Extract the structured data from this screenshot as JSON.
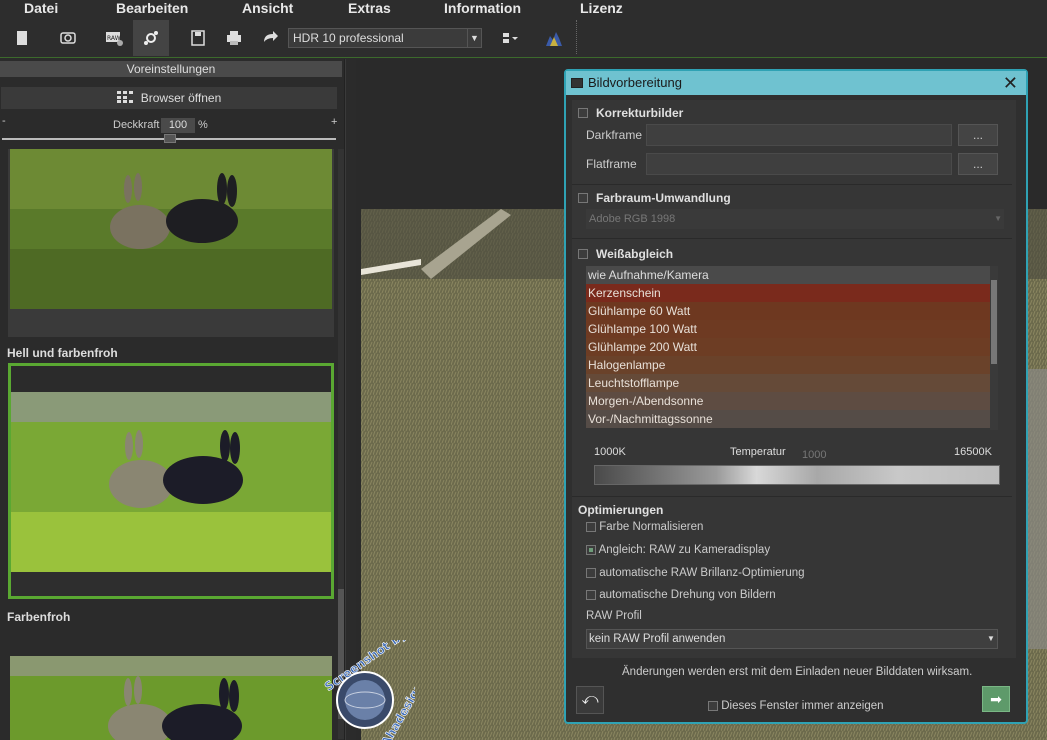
{
  "menu": [
    "Datei",
    "Bearbeiten",
    "Ansicht",
    "Extras",
    "Information",
    "Lizenz"
  ],
  "toolbar": {
    "preset_value": "HDR 10 professional",
    "icons": [
      "new-file-icon",
      "camera-icon",
      "raw-icon",
      "bracket-icon",
      "save-icon",
      "print-icon",
      "share-icon",
      "layout-icon",
      "histogram-icon"
    ]
  },
  "left_panel": {
    "header": "Voreinstellungen",
    "browser_button": "Browser öffnen",
    "opacity_label": "Deckkraft",
    "opacity_value": "100",
    "opacity_unit": "%",
    "slider_min": "-",
    "slider_max": "+",
    "presets": [
      {
        "title": ""
      },
      {
        "title": "Hell und farbenfroh"
      },
      {
        "title": "Farbenfroh"
      }
    ]
  },
  "dialog": {
    "title": "Bildvorbereitung",
    "korrektur": {
      "title": "Korrekturbilder",
      "darkframe_label": "Darkframe",
      "flatframe_label": "Flatframe",
      "browse_label": "..."
    },
    "farbraum": {
      "title": "Farbraum-Umwandlung",
      "value": "Adobe RGB 1998"
    },
    "weissabgleich": {
      "title": "Weißabgleich",
      "items": [
        {
          "label": "wie Aufnahme/Kamera",
          "color": "#4a4a4a"
        },
        {
          "label": "Kerzenschein",
          "color": "#7a2a1c"
        },
        {
          "label": "Glühlampe 60 Watt",
          "color": "#6e3820"
        },
        {
          "label": "Glühlampe 100 Watt",
          "color": "#6e3a22"
        },
        {
          "label": "Glühlampe 200 Watt",
          "color": "#6d3d24"
        },
        {
          "label": "Halogenlampe",
          "color": "#6a422a"
        },
        {
          "label": "Leuchtstofflampe",
          "color": "#654a38"
        },
        {
          "label": "Morgen-/Abendsonne",
          "color": "#5e4c42"
        },
        {
          "label": "Vor-/Nachmittagssonne",
          "color": "#554c47"
        }
      ],
      "temp_min": "1000K",
      "temp_label": "Temperatur",
      "temp_value": "1000",
      "temp_max": "16500K"
    },
    "optimierungen": {
      "title": "Optimierungen",
      "options": [
        {
          "label": "Farbe Normalisieren",
          "checked": false
        },
        {
          "label": "Angleich: RAW zu Kameradisplay",
          "checked": true
        },
        {
          "label": "automatische RAW Brillanz-Optimierung",
          "checked": false
        },
        {
          "label": "automatische Drehung von Bildern",
          "checked": false
        }
      ],
      "raw_profile_label": "RAW Profil",
      "raw_profile_value": "kein RAW Profil anwenden"
    },
    "note": "Änderungen werden erst mit dem Einladen neuer Bilddaten wirksam.",
    "always_show_label": "Dieses Fenster immer anzeigen"
  },
  "watermark": {
    "top": "Screenshot by",
    "bottom": "Ahadesign.eu"
  }
}
